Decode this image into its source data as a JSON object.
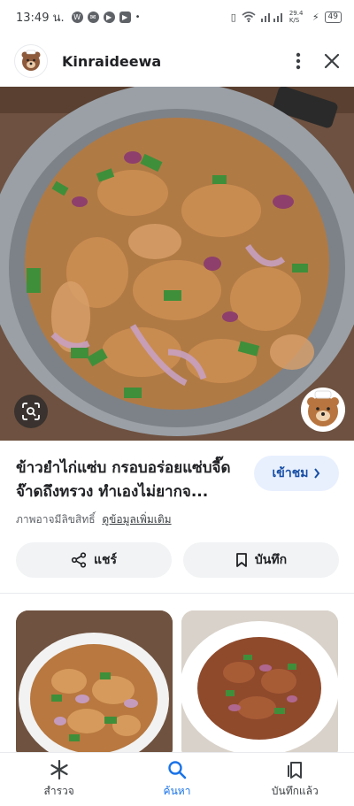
{
  "status_bar": {
    "time": "13:49 น.",
    "speed": "29.4 K/S",
    "battery": "49",
    "icons": [
      "whatsapp-icon",
      "chat-icon",
      "play-icon",
      "youtube-icon",
      "vibrate-icon",
      "wifi-icon",
      "signal-icon",
      "charging-icon",
      "battery-icon"
    ]
  },
  "header": {
    "site_name": "Kinraideewa"
  },
  "result": {
    "title": "ข้าวยำไก่แซ่บ กรอบอร่อยแซ่บจี๊ดจ๊าดถึงทรวง ทำเองไม่ยากจ...",
    "visit_label": "เข้าชม",
    "copyright_text": "ภาพอาจมีลิขสิทธิ์",
    "more_info": "ดูข้อมูลเพิ่มเติม",
    "share_label": "แชร์",
    "save_label": "บันทึก"
  },
  "bottom_nav": {
    "items": [
      {
        "label": "สำรวจ",
        "icon": "asterisk-icon"
      },
      {
        "label": "ค้นหา",
        "icon": "search-icon",
        "active": true
      },
      {
        "label": "บันทึกแล้ว",
        "icon": "bookmarks-icon"
      }
    ]
  },
  "colors": {
    "accent": "#1a73e8",
    "visit_bg": "#e8f0fe",
    "pill_bg": "#f1f3f4"
  }
}
